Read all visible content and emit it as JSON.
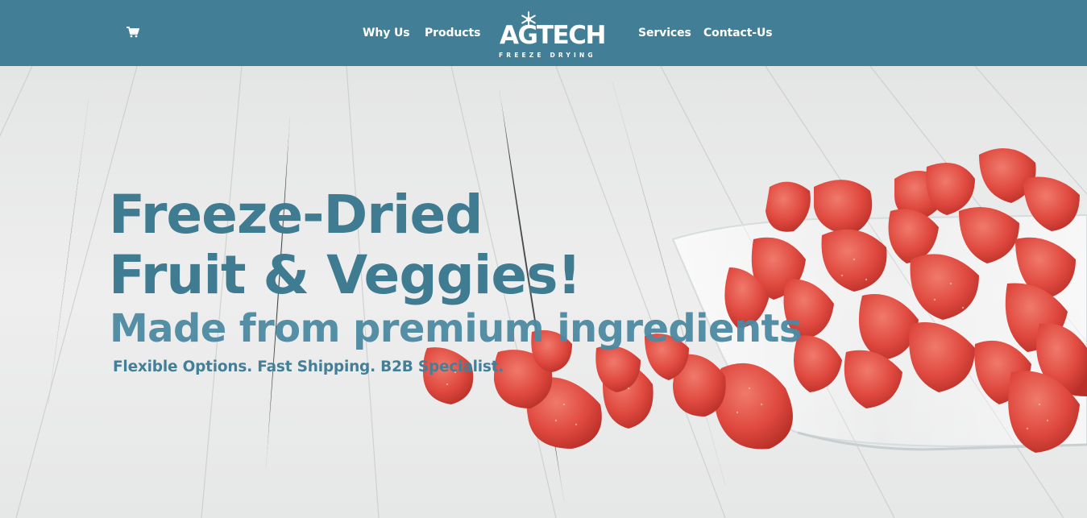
{
  "header": {
    "brand": {
      "name": "AGTECH",
      "tagline": "FREEZE DRYING"
    },
    "nav": {
      "why_us": "Why Us",
      "products": "Products",
      "services": "Services",
      "contact": "Contact-Us"
    },
    "cart_icon": "shopping-cart-icon",
    "logo_icon": "snowflake-icon"
  },
  "hero": {
    "title_line1": "Freeze-Dried",
    "title_line2": "Fruit & Veggies!",
    "subtitle": "Made from premium ingredients",
    "tagline": "Flexible Options. Fast Shipping. B2B Specialist."
  },
  "colors": {
    "header_bg": "#427f97",
    "accent": "#3f7b91",
    "nav_text": "#ffffff",
    "strawberry": "#d9473f"
  }
}
